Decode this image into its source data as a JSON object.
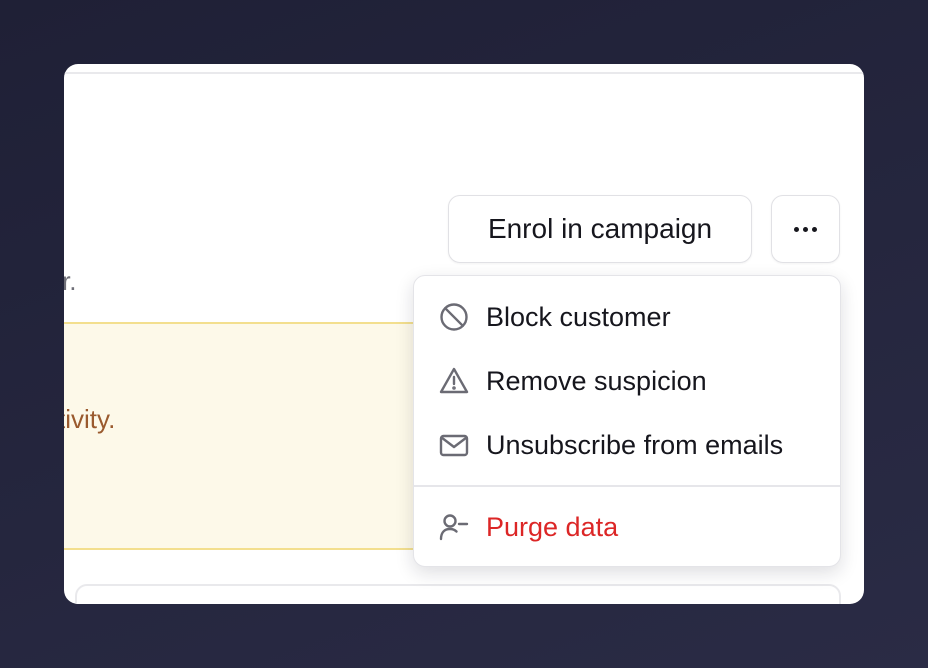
{
  "header": {
    "enrol_button_label": "Enrol in campaign",
    "more_button_icon": "more-horizontal-icon"
  },
  "content": {
    "description_fragment": "r.",
    "alert_fragment": "tivity."
  },
  "menu": {
    "items": [
      {
        "label": "Block customer",
        "icon": "ban-icon"
      },
      {
        "label": "Remove suspicion",
        "icon": "warning-triangle-icon"
      },
      {
        "label": "Unsubscribe from emails",
        "icon": "mail-icon"
      }
    ],
    "danger_item": {
      "label": "Purge data",
      "icon": "user-minus-icon",
      "color": "#dc2626"
    }
  },
  "colors": {
    "background": "#23243b",
    "danger": "#dc2626",
    "alert_background": "#fdf9e9",
    "alert_text": "#9a5a2e"
  }
}
